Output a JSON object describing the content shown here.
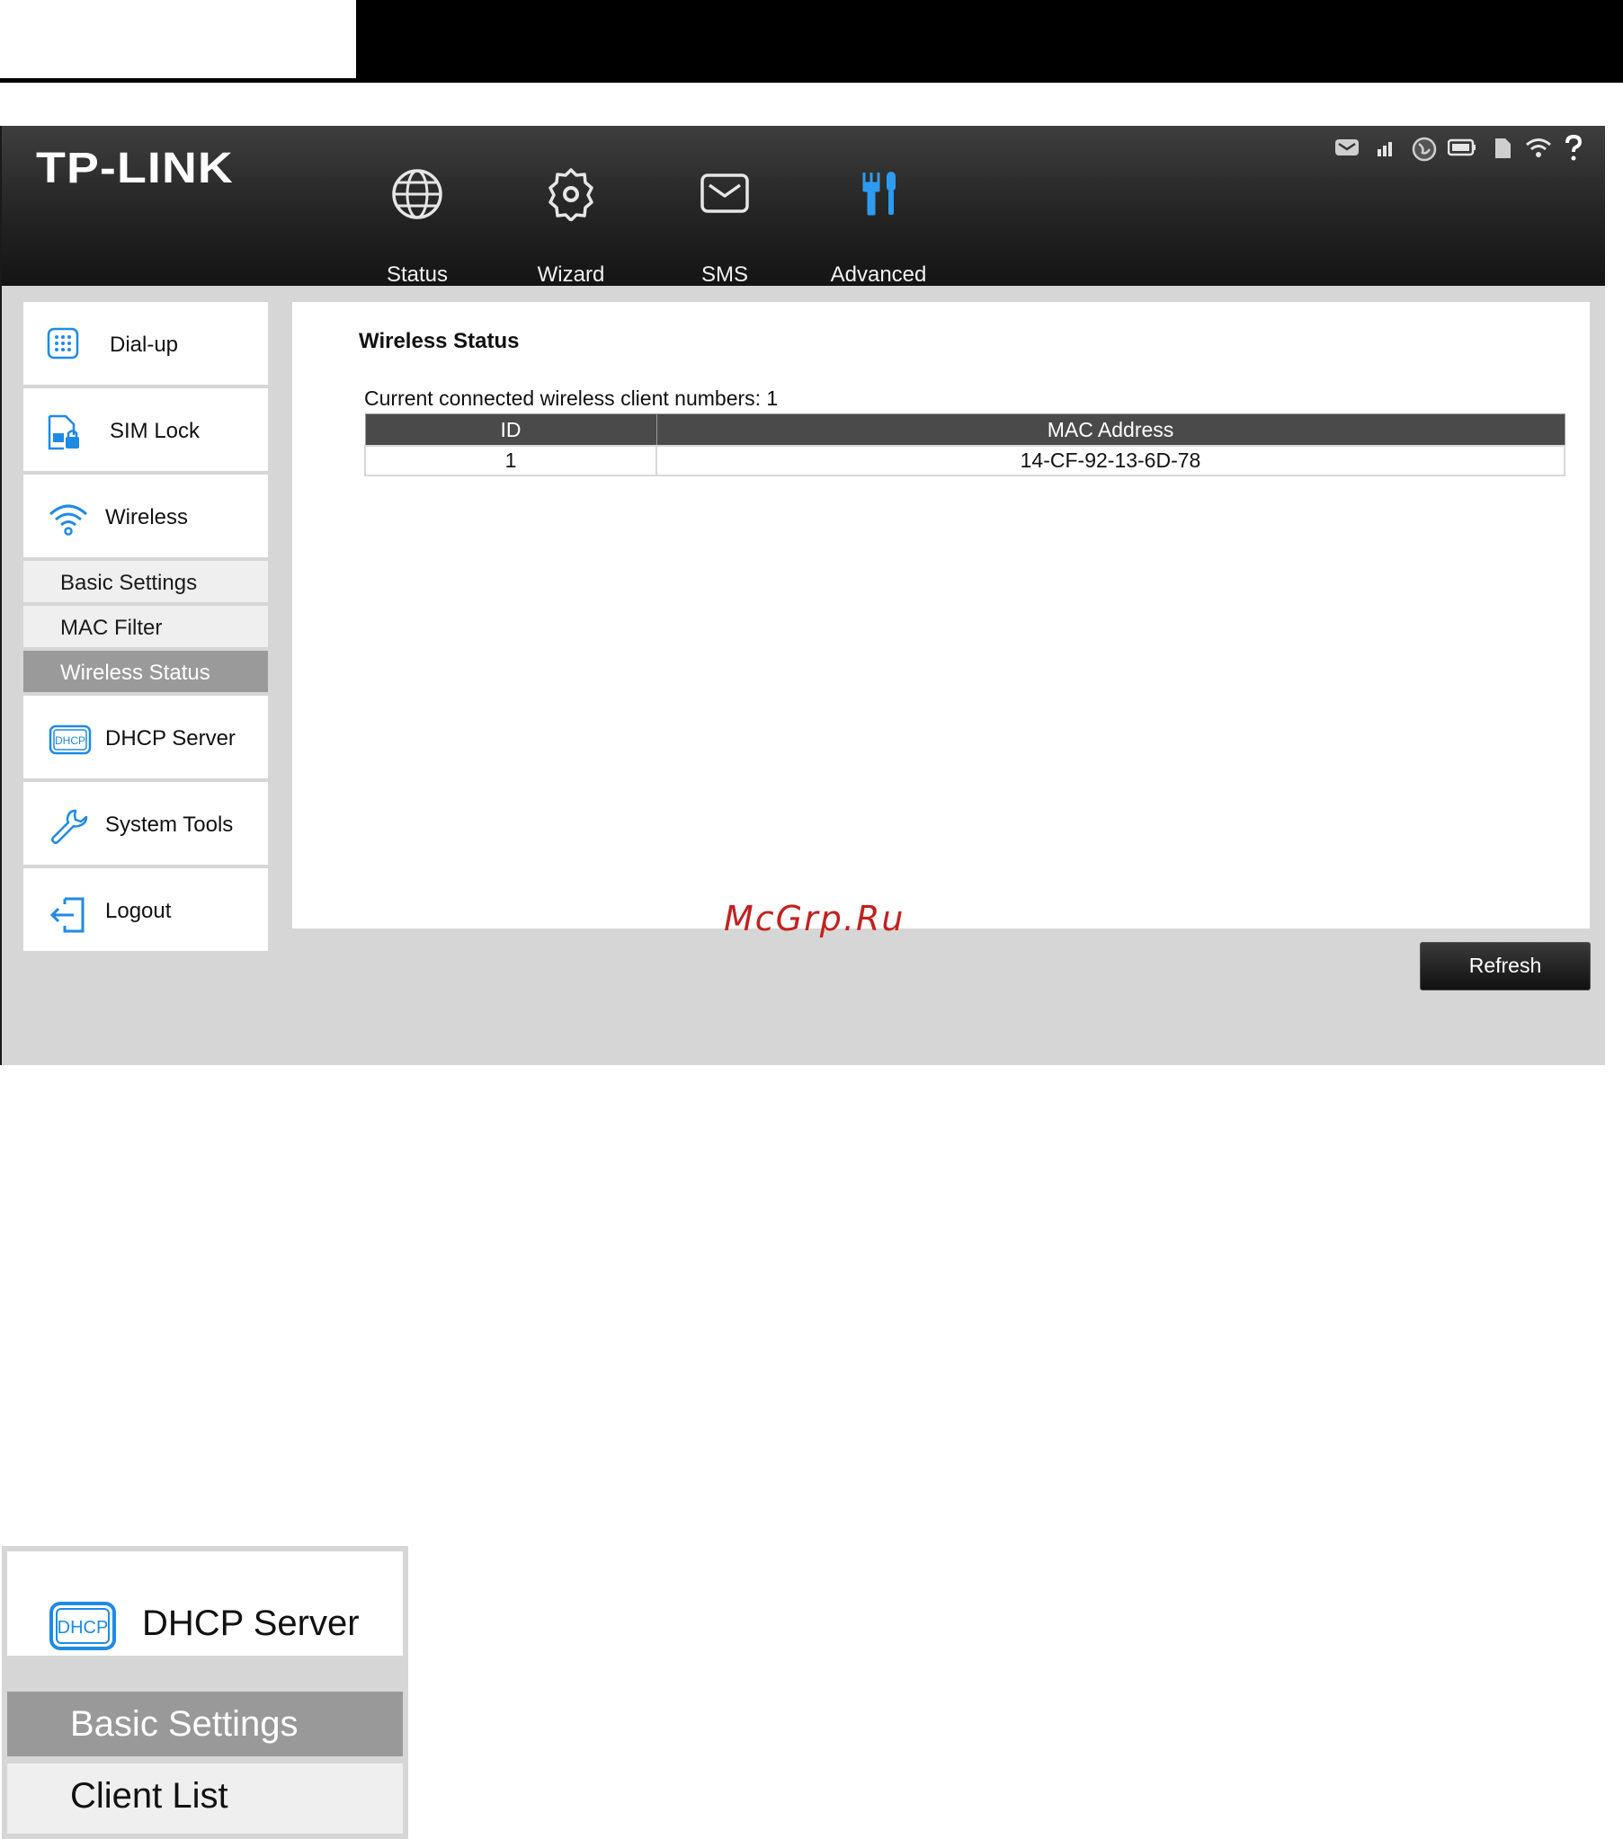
{
  "brand": {
    "logo_text": "TP-LINK"
  },
  "nav": {
    "items": [
      {
        "label": "Status",
        "icon": "globe-icon"
      },
      {
        "label": "Wizard",
        "icon": "gear-icon"
      },
      {
        "label": "SMS",
        "icon": "envelope-icon"
      },
      {
        "label": "Advanced",
        "icon": "tools-icon",
        "active": true
      }
    ]
  },
  "status_bar": {
    "icons": [
      "message-icon",
      "signal-icon",
      "internet-icon",
      "battery-icon",
      "sd-card-icon",
      "wifi-icon",
      "help-icon"
    ]
  },
  "sidebar": {
    "items": [
      {
        "label": "Dial-up",
        "icon": "dialpad-icon"
      },
      {
        "label": "SIM Lock",
        "icon": "sim-lock-icon"
      },
      {
        "label": "Wireless",
        "icon": "wifi-icon"
      },
      {
        "label": "DHCP Server",
        "icon": "dhcp-icon"
      },
      {
        "label": "System Tools",
        "icon": "wrench-icon"
      },
      {
        "label": "Logout",
        "icon": "logout-icon"
      }
    ],
    "wireless_sub": [
      {
        "label": "Basic Settings"
      },
      {
        "label": "MAC Filter"
      },
      {
        "label": "Wireless Status",
        "active": true
      }
    ]
  },
  "content": {
    "title": "Wireless Status",
    "client_count_text": "Current connected wireless client numbers: 1",
    "table": {
      "headers": [
        "ID",
        "MAC Address"
      ],
      "rows": [
        [
          "1",
          "14-CF-92-13-6D-78"
        ]
      ]
    },
    "refresh_label": "Refresh"
  },
  "watermark": "McGrp.Ru",
  "zoom_menu": {
    "header_label": "DHCP Server",
    "items": [
      {
        "label": "Basic Settings",
        "active": true
      },
      {
        "label": "Client List"
      }
    ]
  },
  "colors": {
    "accent_blue": "#1e8ae6",
    "header_dark": "#1c1c1c",
    "active_gray": "#9a9a9a",
    "watermark_red": "#c42020"
  }
}
